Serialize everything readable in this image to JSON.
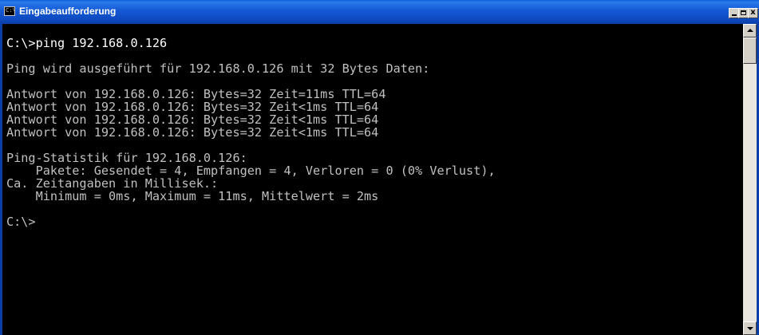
{
  "window": {
    "title": "Eingabeaufforderung",
    "icon": "console-icon",
    "icon_glyph": "C:\\",
    "titlebar_color": "#0E4AC0"
  },
  "controls": {
    "minimize": "minimize-icon",
    "maximize": "maximize-icon",
    "close": "close-icon",
    "close_glyph": "x"
  },
  "console": {
    "text_color": "#C0C0C0",
    "background": "#000000",
    "lines": [
      "C:\\>ping 192.168.0.126",
      "Ping wird ausgeführt für 192.168.0.126 mit 32 Bytes Daten:",
      "Antwort von 192.168.0.126: Bytes=32 Zeit=11ms TTL=64",
      "Antwort von 192.168.0.126: Bytes=32 Zeit<1ms TTL=64",
      "Antwort von 192.168.0.126: Bytes=32 Zeit<1ms TTL=64",
      "Antwort von 192.168.0.126: Bytes=32 Zeit<1ms TTL=64",
      "Ping-Statistik für 192.168.0.126:",
      "    Pakete: Gesendet = 4, Empfangen = 4, Verloren = 0 (0% Verlust),",
      "Ca. Zeitangaben in Millisek.:",
      "    Minimum = 0ms, Maximum = 11ms, Mittelwert = 2ms",
      "C:\\>"
    ]
  },
  "scrollbar": {
    "up": "scroll-up-arrow-icon",
    "down": "scroll-down-arrow-icon"
  }
}
